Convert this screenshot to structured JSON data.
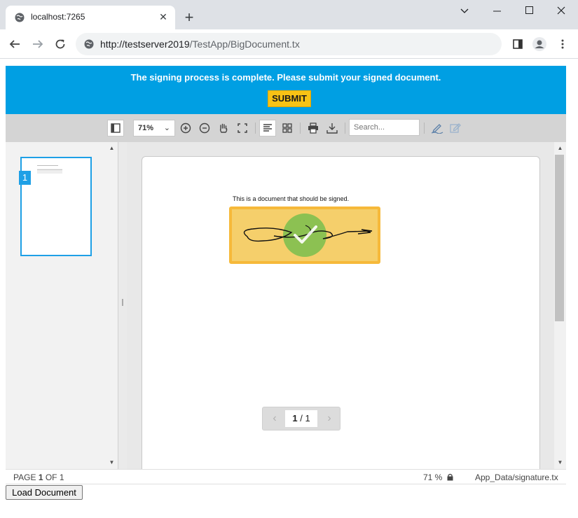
{
  "browser": {
    "tab_title": "localhost:7265",
    "tab_close": "✕",
    "new_tab": "+",
    "url_host": "http://testserver2019",
    "url_path": "/TestApp/BigDocument.tx",
    "window_controls": {
      "dropdown": "⌄",
      "minimize": "—",
      "maximize": "☐",
      "close": "✕"
    }
  },
  "banner": {
    "message": "The signing process is complete. Please submit your signed document.",
    "submit_label": "SUBMIT",
    "bg_color": "#009fe3",
    "button_color": "#f8c315"
  },
  "toolbar": {
    "zoom_value": "71%",
    "search_placeholder": "Search..."
  },
  "thumbnails": {
    "items": [
      {
        "number": "1"
      }
    ]
  },
  "document": {
    "text": "This is a document that should be signed."
  },
  "pager": {
    "current": "1",
    "separator": "/",
    "total": "1"
  },
  "status": {
    "page_prefix": "PAGE",
    "page_current": "1",
    "page_of": "OF",
    "page_total": "1",
    "zoom": "71 %",
    "file": "App_Data/signature.tx"
  },
  "load_button": "Load Document",
  "icons": [
    "globe-icon",
    "close-icon",
    "plus-icon",
    "back-icon",
    "forward-icon",
    "reload-icon",
    "info-icon",
    "sidepanel-icon",
    "profile-icon",
    "menu-icon",
    "toggle-sidebar-icon",
    "zoom-in-icon",
    "zoom-out-icon",
    "pan-hand-icon",
    "fit-page-icon",
    "single-page-icon",
    "grid-view-icon",
    "print-icon",
    "download-icon",
    "sign-pen-icon",
    "edit-icon",
    "chevron-left-icon",
    "chevron-right-icon",
    "lock-icon",
    "checkmark-icon"
  ]
}
